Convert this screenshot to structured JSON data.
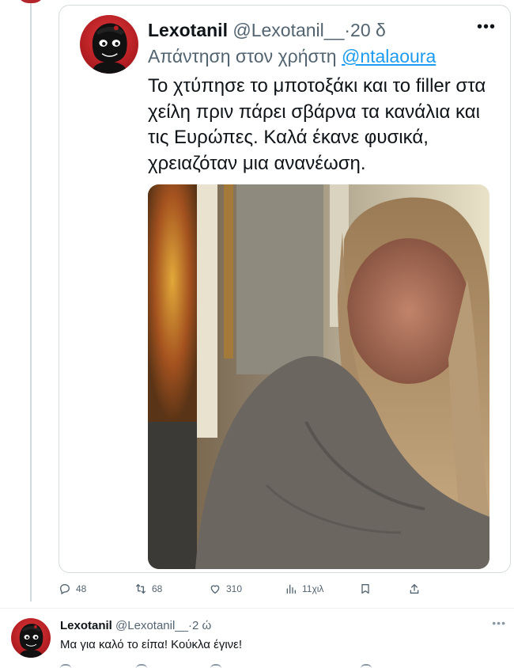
{
  "quoted_tweet": {
    "display_name": "Lexotanil",
    "handle": "@Lexotanil__",
    "separator": "·",
    "time": "20 δ",
    "reply_prefix": "Απάντηση στον χρήστη",
    "reply_mention": "@ntalaoura",
    "text": "Το χτύπησε το μποτοξάκι και το filler στα χείλη πριν πάρει σβάρνα τα κανάλια και τις Ευρώπες. Καλά έκανε φυσικά, χρειαζόταν μια ανανέωση.",
    "more_icon": "more-horizontal-icon",
    "photo_icon": "photo-image"
  },
  "actions": {
    "replies": "48",
    "retweets": "68",
    "likes": "310",
    "views": "11χιλ",
    "icons": [
      "reply-icon",
      "retweet-icon",
      "like-icon",
      "views-icon",
      "bookmark-icon",
      "share-icon"
    ]
  },
  "reply_tweet": {
    "display_name": "Lexotanil",
    "handle": "@Lexotanil__",
    "separator": "·",
    "time": "2 ώ",
    "text": "Μα για καλό το είπα! Κούκλα έγινε!"
  },
  "colors": {
    "link": "#1d9bf0",
    "muted": "#536471",
    "avatar_red": "#b51f24",
    "border": "#d5dbe0"
  }
}
